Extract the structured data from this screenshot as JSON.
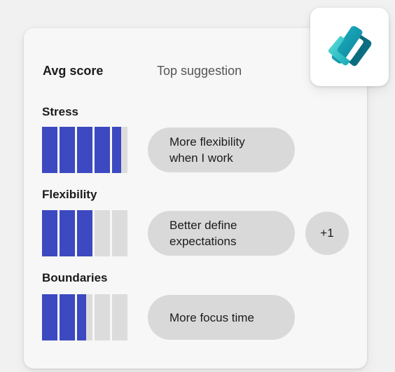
{
  "header": {
    "avg_score_label": "Avg score",
    "top_suggestion_label": "Top suggestion"
  },
  "metrics": [
    {
      "name": "Stress",
      "score_level": 0.92,
      "bar_count": 5,
      "suggestion": "More flexibility\nwhen I work",
      "extra": ""
    },
    {
      "name": "Flexibility",
      "score_level": 0.6,
      "bar_count": 5,
      "suggestion": "Better define\nexpectations",
      "extra": "+1"
    },
    {
      "name": "Boundaries",
      "score_level": 0.52,
      "bar_count": 5,
      "suggestion": "More focus time",
      "extra": ""
    }
  ],
  "colors": {
    "bar_fill": "#3c49c0",
    "bar_empty": "#dcdcdc",
    "pill": "#d9d9d9",
    "card": "#f7f7f7"
  },
  "icons": {
    "logo": "viva-insights-logo-icon"
  }
}
